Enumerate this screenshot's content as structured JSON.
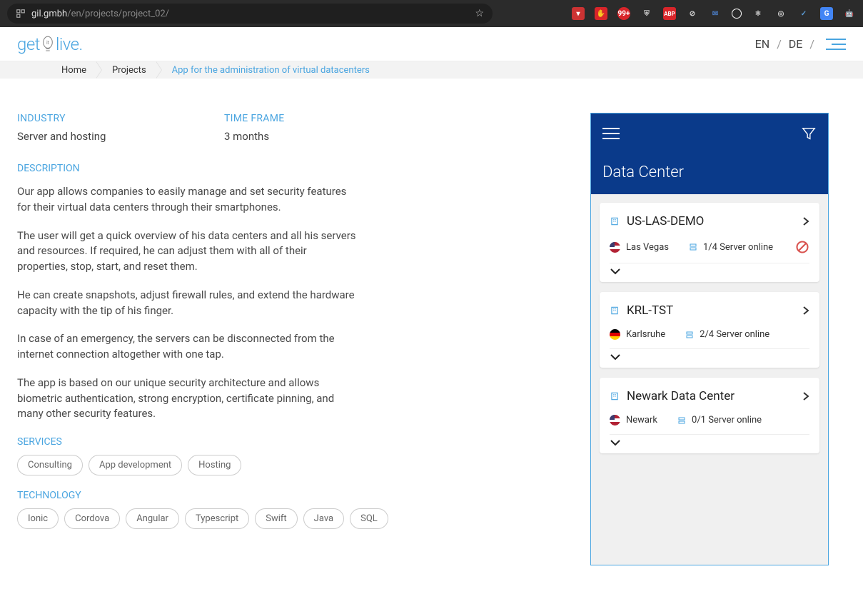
{
  "browser": {
    "url_host": "gil.gmbh",
    "url_path": "/en/projects/project_02/",
    "ext_badge": "99+",
    "ext_abp": "ABP"
  },
  "header": {
    "logo_get": "get",
    "logo_live": "live.",
    "lang_en": "EN",
    "lang_de": "DE",
    "sep": "/"
  },
  "breadcrumb": {
    "home": "Home",
    "projects": "Projects",
    "current": "App for the administration of virtual datacenters"
  },
  "info": {
    "industry_label": "INDUSTRY",
    "industry_value": "Server and hosting",
    "timeframe_label": "TIME FRAME",
    "timeframe_value": "3 months"
  },
  "description": {
    "label": "DESCRIPTION",
    "p1": "Our app allows companies to easily manage and set security features for their virtual data centers through their smartphones.",
    "p2": "The user will get a quick overview of his data centers and all his servers and resources. If required, he can adjust them with all of their properties, stop, start, and reset them.",
    "p3": "He can create snapshots, adjust firewall rules, and extend the hardware capacity with the tip of his finger.",
    "p4": "In case of an emergency, the servers can be disconnected from the internet connection altogether with one tap.",
    "p5": "The app is based on our unique security architecture and allows biometric authentication, strong encryption, certificate pinning, and many other security features."
  },
  "services": {
    "label": "SERVICES",
    "items": [
      "Consulting",
      "App development",
      "Hosting"
    ]
  },
  "technology": {
    "label": "TECHNOLOGY",
    "items": [
      "Ionic",
      "Cordova",
      "Angular",
      "Typescript",
      "Swift",
      "Java",
      "SQL"
    ]
  },
  "phone": {
    "title": "Data Center",
    "cards": [
      {
        "name": "US-LAS-DEMO",
        "location": "Las Vegas",
        "flag": "us",
        "status": "1/4 Server online",
        "warn": true
      },
      {
        "name": "KRL-TST",
        "location": "Karlsruhe",
        "flag": "de",
        "status": "2/4 Server online",
        "warn": false
      },
      {
        "name": "Newark Data Center",
        "location": "Newark",
        "flag": "us",
        "status": "0/1 Server online",
        "warn": false
      }
    ]
  }
}
